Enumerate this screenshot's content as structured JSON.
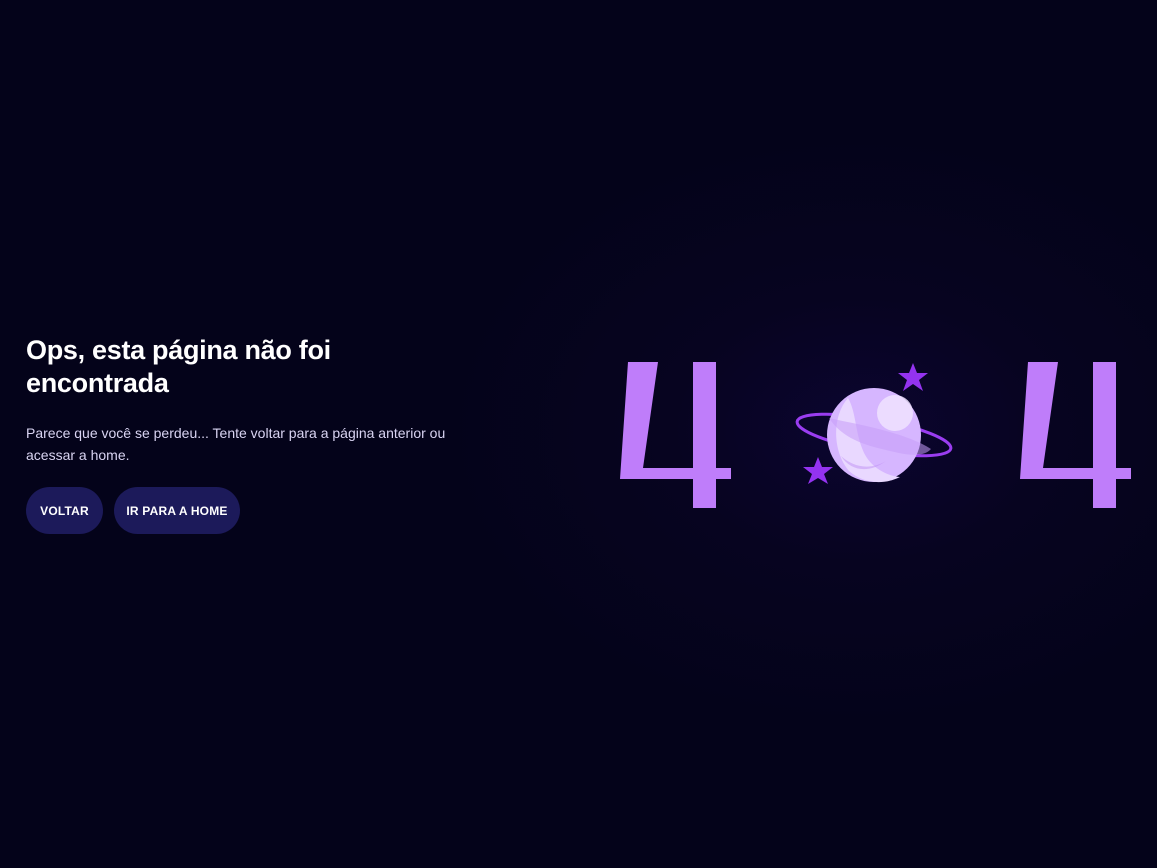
{
  "error": {
    "title": "Ops, esta página não foi encontrada",
    "description": "Parece que você se perdeu... Tente voltar para a página anterior ou acessar a home.",
    "code_left_digit": "4",
    "code_right_digit": "4"
  },
  "actions": {
    "back_label": "VOLTAR",
    "home_label": "IR PARA A HOME"
  },
  "colors": {
    "background": "#04031a",
    "button": "#1c1a5a",
    "digit": "#bf7dfa",
    "planet": "#d9b8ff",
    "ring": "#9a3df0",
    "star": "#9433f0"
  },
  "icons": [
    "planet-icon",
    "star-icon"
  ]
}
